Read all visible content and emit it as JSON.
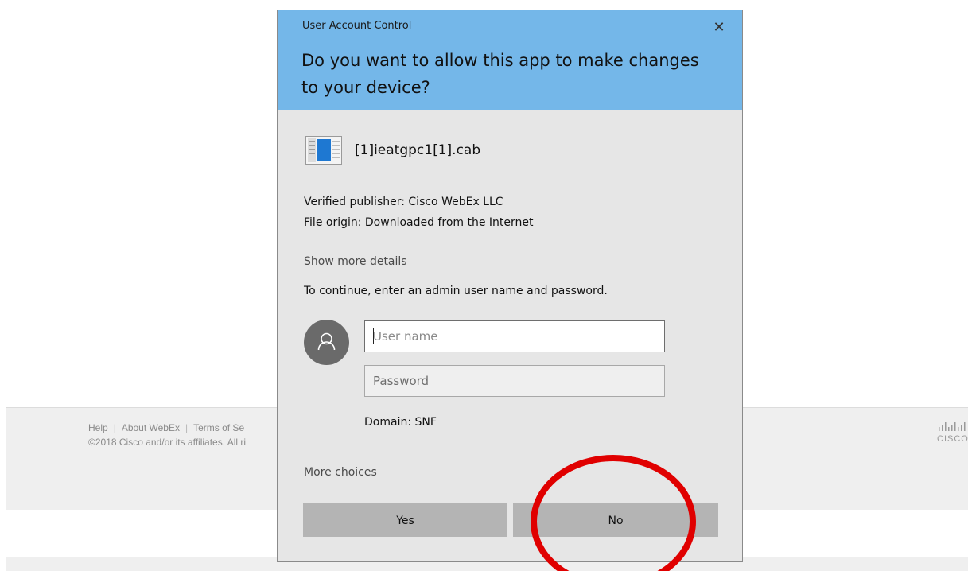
{
  "background": {
    "footer_links": [
      "Help",
      "About WebEx",
      "Terms of Se"
    ],
    "copyright": "©2018 Cisco and/or its affiliates. All ri",
    "logo_text": "CISCO"
  },
  "uac": {
    "window_title": "User Account Control",
    "close_label": "✕",
    "question": "Do you want to allow this app to make changes to your device?",
    "app_name": "[1]ieatgpc1[1].cab",
    "publisher": "Verified publisher: Cisco WebEx LLC",
    "origin": "File origin: Downloaded from the Internet",
    "show_more_details": "Show more details",
    "continue_text": "To continue, enter an admin user name and password.",
    "username_placeholder": "User name",
    "password_placeholder": "Password",
    "domain": "Domain: SNF",
    "more_choices": "More choices",
    "yes_label": "Yes",
    "no_label": "No"
  },
  "colors": {
    "header_accent": "#74b7e9",
    "dialog_bg": "#e6e6e6",
    "button_bg": "#b4b4b4",
    "annotation_circle": "#e00000"
  }
}
